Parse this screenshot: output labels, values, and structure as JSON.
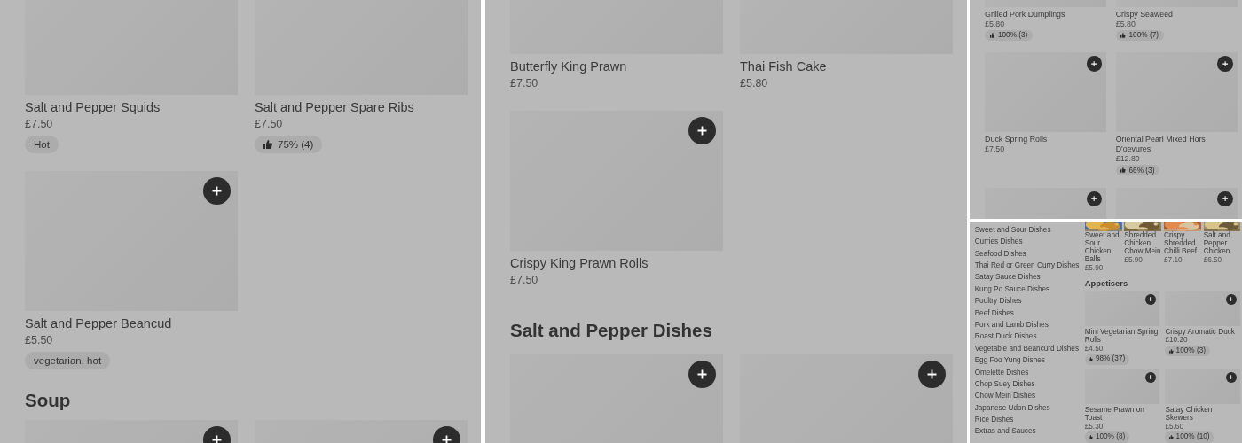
{
  "panels": [
    {
      "blocks": [
        {
          "kind": "row",
          "items": [
            {
              "kind": "dish",
              "name": "Salt and Pepper Squids",
              "price": "£7.50",
              "tags": [
                "Hot"
              ]
            },
            {
              "kind": "dish",
              "name": "Salt and Pepper Spare Ribs",
              "price": "£7.50",
              "rating": "75% (4)"
            }
          ]
        },
        {
          "kind": "row",
          "items": [
            {
              "kind": "dish",
              "name": "Salt and Pepper Beancud",
              "price": "£5.50",
              "tags": [
                "vegetarian, hot"
              ]
            }
          ]
        },
        {
          "kind": "heading",
          "text": "Soup"
        },
        {
          "kind": "row"
        }
      ]
    },
    {
      "blocks": [
        {
          "kind": "row",
          "items": [
            {
              "kind": "dish",
              "name": "Butterfly King Prawn",
              "price": "£7.50"
            },
            {
              "kind": "dish",
              "name": "Thai Fish Cake",
              "price": "£5.80"
            }
          ]
        },
        {
          "kind": "row",
          "items": [
            {
              "kind": "dish",
              "name": "Crispy King Prawn Rolls",
              "price": "£7.50"
            }
          ]
        },
        {
          "kind": "heading",
          "text": "Salt and Pepper Dishes"
        },
        {
          "kind": "row"
        }
      ]
    },
    {
      "blocks": [
        {
          "kind": "row",
          "items": [
            {
              "kind": "dish",
              "name": "Grilled Pork Dumplings",
              "price": "£5.80",
              "rating": "100% (3)"
            },
            {
              "kind": "dish",
              "name": "Crispy Seaweed",
              "price": "£5.80",
              "rating": "100% (7)"
            }
          ]
        },
        {
          "kind": "row",
          "items": [
            {
              "kind": "dish",
              "name": "Duck Spring Rolls",
              "price": "£7.50"
            },
            {
              "kind": "dish",
              "name": "Oriental Pearl Mixed Hors D'oevures",
              "price": "£12.80",
              "rating": "66% (3)"
            }
          ]
        },
        {
          "kind": "row"
        }
      ]
    },
    {
      "sidebar": {
        "items": [
          "Sweet and Sour Dishes",
          "Curries Dishes",
          "Seafood Dishes",
          "Thai Red or Green Curry Dishes",
          "Satay Sauce Dishes",
          "Kung Po Sauce Dishes",
          "Poultry Dishes",
          "Beef Dishes",
          "Pork and Lamb Dishes",
          "Roast Duck Dishes",
          "Vegetable and Beancurd Dishes",
          "Egg Foo Yung Dishes",
          "Omelette Dishes",
          "Chop Suey Dishes",
          "Chow Mein Dishes",
          "Japanese Udon Dishes",
          "Rice Dishes",
          "Extras and Sauces"
        ]
      },
      "blocks": [
        {
          "kind": "photo-row",
          "items": [
            {
              "name": "Sweet and Sour Chicken Balls",
              "price": "£5.90"
            },
            {
              "name": "Shredded Chicken Chow Mein",
              "price": "£5.90"
            },
            {
              "name": "Crispy Shredded Chilli Beef",
              "price": "£7.10"
            },
            {
              "name": "Salt and Pepper Chicken",
              "price": "£6.50"
            }
          ]
        },
        {
          "kind": "heading",
          "text": "Appetisers"
        },
        {
          "kind": "row",
          "items": [
            {
              "kind": "dish",
              "name": "Mini Vegetarian Spring Rolls",
              "price": "£4.50",
              "rating": "98% (37)"
            },
            {
              "kind": "dish",
              "name": "Crispy Aromatic Duck",
              "price": "£10.20",
              "rating": "100% (3)"
            }
          ]
        },
        {
          "kind": "row",
          "items": [
            {
              "kind": "dish",
              "name": "Sesame Prawn on Toast",
              "price": "£5.30",
              "rating": "100% (8)"
            },
            {
              "kind": "dish",
              "name": "Satay Chicken Skewers",
              "price": "£5.60",
              "rating": "100% (10)"
            }
          ]
        }
      ]
    }
  ]
}
